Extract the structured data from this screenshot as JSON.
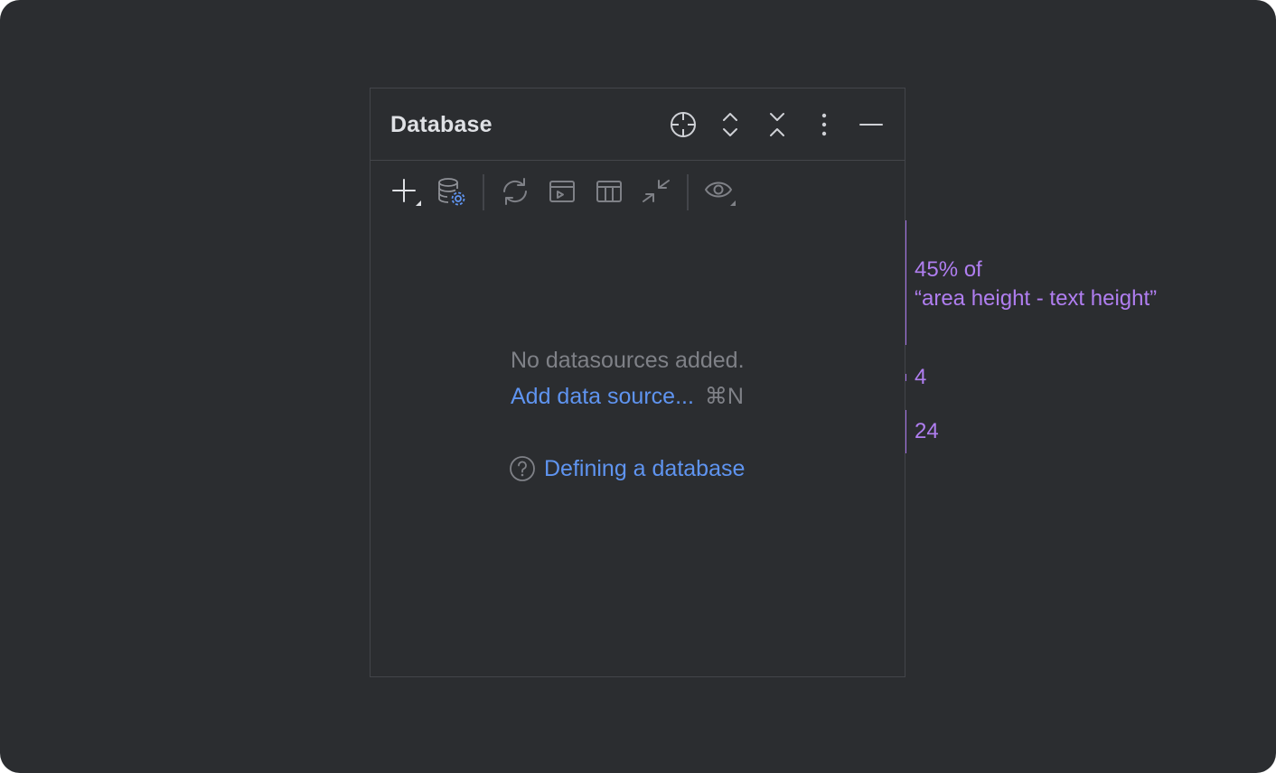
{
  "panel": {
    "title": "Database",
    "header_icons": [
      "locate-icon",
      "expand-all-icon",
      "collapse-all-icon",
      "more-options-icon",
      "minimize-icon"
    ],
    "toolbar_icons": [
      "add-icon",
      "data-source-properties-icon",
      "refresh-icon",
      "query-console-icon",
      "table-icon",
      "jump-to-source-icon",
      "view-options-icon"
    ]
  },
  "empty_state": {
    "message": "No datasources added.",
    "add_link": "Add data source...",
    "add_shortcut": "⌘N",
    "help_link": "Defining a database"
  },
  "annotations": {
    "top_gap_line1": "45% of",
    "top_gap_line2": "“area height - text height”",
    "small_gap": "4",
    "large_gap": "24"
  },
  "colors": {
    "background": "#2b2d30",
    "border": "#43454a",
    "title_text": "#dfe1e5",
    "muted_text": "#7f8187",
    "link": "#5f94f0",
    "highlight_fill": "#49385e",
    "highlight_marker": "#a571e6",
    "annotation_text": "#b07ef0"
  }
}
